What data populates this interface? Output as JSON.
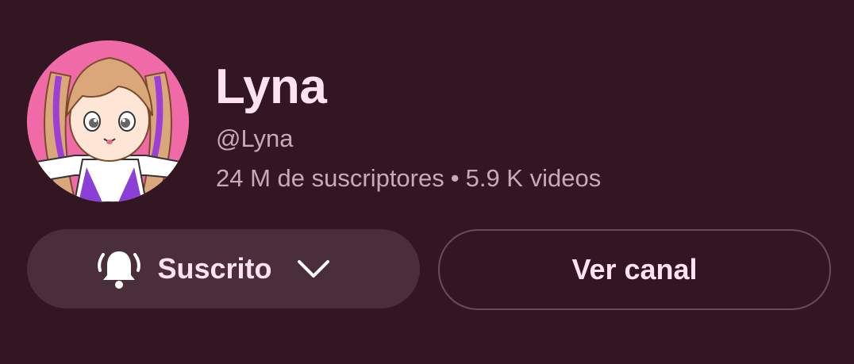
{
  "channel": {
    "name": "Lyna",
    "handle": "@Lyna",
    "subscribers": "24 M de suscriptores",
    "separator": "•",
    "videos": "5.9 K videos",
    "avatar_icon": "channel-avatar-cartoon-girl"
  },
  "buttons": {
    "subscribe_label": "Suscrito",
    "subscribe_icon": "bell-ringing-icon",
    "subscribe_dropdown_icon": "chevron-down-icon",
    "view_channel_label": "Ver canal"
  },
  "colors": {
    "background": "#321723",
    "title": "#ffe4ef",
    "meta_text": "#c9a9b9",
    "subscribe_bg": "#4a2e3a",
    "outline": "#6b4b59",
    "avatar_bg": "#f06aa8"
  }
}
